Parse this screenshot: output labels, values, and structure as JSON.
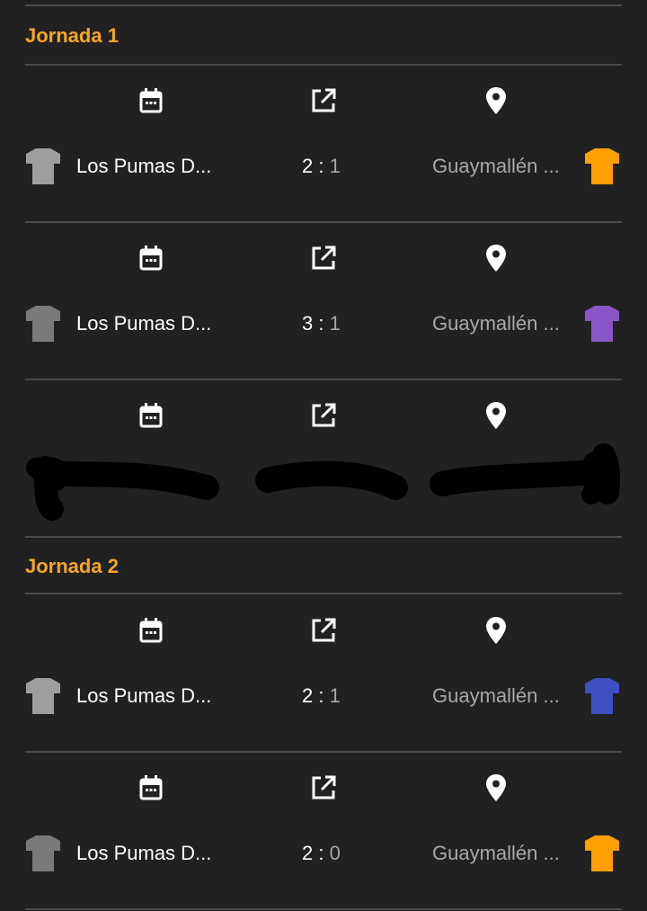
{
  "jornadas": [
    {
      "title": "Jornada 1",
      "matches": [
        {
          "home": "Los Pumas D...",
          "away": "Guaymallén ...",
          "score_home": "2",
          "score_away": "1",
          "home_shirt": "#9e9e9e",
          "away_shirt": "#ff9f00"
        },
        {
          "home": "Los Pumas D...",
          "away": "Guaymallén ...",
          "score_home": "3",
          "score_away": "1",
          "home_shirt": "#7a7a7a",
          "away_shirt": "#8a55c9"
        },
        {
          "redacted": true
        }
      ]
    },
    {
      "title": "Jornada 2",
      "matches": [
        {
          "home": "Los Pumas D...",
          "away": "Guaymallén ...",
          "score_home": "2",
          "score_away": "1",
          "home_shirt": "#9e9e9e",
          "away_shirt": "#3e4fc4"
        },
        {
          "home": "Los Pumas D...",
          "away": "Guaymallén ...",
          "score_home": "2",
          "score_away": "0",
          "home_shirt": "#7a7a7a",
          "away_shirt": "#ff9f00"
        }
      ]
    }
  ],
  "score_separator": ":",
  "icons": {
    "date": "calendar-icon",
    "open": "open-in-new-icon",
    "location": "location-pin-icon",
    "shirt": "shirt-icon"
  },
  "colors": {
    "background": "#212121",
    "accent": "#f5a623",
    "divider": "#4a4a4a",
    "muted_text": "#a8a8a8"
  }
}
